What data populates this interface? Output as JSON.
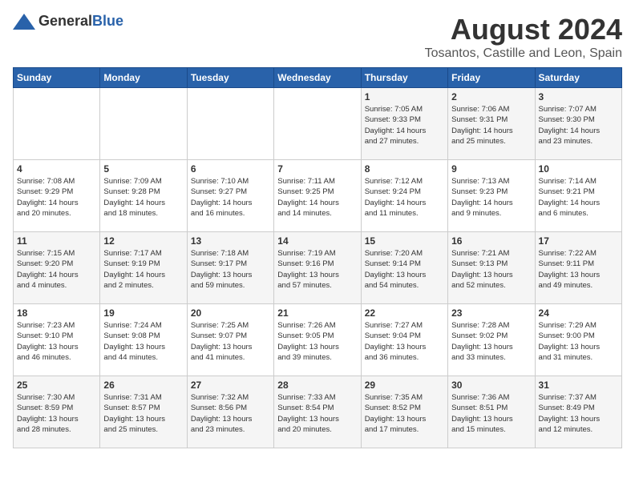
{
  "header": {
    "logo_general": "General",
    "logo_blue": "Blue",
    "month_year": "August 2024",
    "location": "Tosantos, Castille and Leon, Spain"
  },
  "days_of_week": [
    "Sunday",
    "Monday",
    "Tuesday",
    "Wednesday",
    "Thursday",
    "Friday",
    "Saturday"
  ],
  "weeks": [
    [
      {
        "day": "",
        "info": ""
      },
      {
        "day": "",
        "info": ""
      },
      {
        "day": "",
        "info": ""
      },
      {
        "day": "",
        "info": ""
      },
      {
        "day": "1",
        "info": "Sunrise: 7:05 AM\nSunset: 9:33 PM\nDaylight: 14 hours\nand 27 minutes."
      },
      {
        "day": "2",
        "info": "Sunrise: 7:06 AM\nSunset: 9:31 PM\nDaylight: 14 hours\nand 25 minutes."
      },
      {
        "day": "3",
        "info": "Sunrise: 7:07 AM\nSunset: 9:30 PM\nDaylight: 14 hours\nand 23 minutes."
      }
    ],
    [
      {
        "day": "4",
        "info": "Sunrise: 7:08 AM\nSunset: 9:29 PM\nDaylight: 14 hours\nand 20 minutes."
      },
      {
        "day": "5",
        "info": "Sunrise: 7:09 AM\nSunset: 9:28 PM\nDaylight: 14 hours\nand 18 minutes."
      },
      {
        "day": "6",
        "info": "Sunrise: 7:10 AM\nSunset: 9:27 PM\nDaylight: 14 hours\nand 16 minutes."
      },
      {
        "day": "7",
        "info": "Sunrise: 7:11 AM\nSunset: 9:25 PM\nDaylight: 14 hours\nand 14 minutes."
      },
      {
        "day": "8",
        "info": "Sunrise: 7:12 AM\nSunset: 9:24 PM\nDaylight: 14 hours\nand 11 minutes."
      },
      {
        "day": "9",
        "info": "Sunrise: 7:13 AM\nSunset: 9:23 PM\nDaylight: 14 hours\nand 9 minutes."
      },
      {
        "day": "10",
        "info": "Sunrise: 7:14 AM\nSunset: 9:21 PM\nDaylight: 14 hours\nand 6 minutes."
      }
    ],
    [
      {
        "day": "11",
        "info": "Sunrise: 7:15 AM\nSunset: 9:20 PM\nDaylight: 14 hours\nand 4 minutes."
      },
      {
        "day": "12",
        "info": "Sunrise: 7:17 AM\nSunset: 9:19 PM\nDaylight: 14 hours\nand 2 minutes."
      },
      {
        "day": "13",
        "info": "Sunrise: 7:18 AM\nSunset: 9:17 PM\nDaylight: 13 hours\nand 59 minutes."
      },
      {
        "day": "14",
        "info": "Sunrise: 7:19 AM\nSunset: 9:16 PM\nDaylight: 13 hours\nand 57 minutes."
      },
      {
        "day": "15",
        "info": "Sunrise: 7:20 AM\nSunset: 9:14 PM\nDaylight: 13 hours\nand 54 minutes."
      },
      {
        "day": "16",
        "info": "Sunrise: 7:21 AM\nSunset: 9:13 PM\nDaylight: 13 hours\nand 52 minutes."
      },
      {
        "day": "17",
        "info": "Sunrise: 7:22 AM\nSunset: 9:11 PM\nDaylight: 13 hours\nand 49 minutes."
      }
    ],
    [
      {
        "day": "18",
        "info": "Sunrise: 7:23 AM\nSunset: 9:10 PM\nDaylight: 13 hours\nand 46 minutes."
      },
      {
        "day": "19",
        "info": "Sunrise: 7:24 AM\nSunset: 9:08 PM\nDaylight: 13 hours\nand 44 minutes."
      },
      {
        "day": "20",
        "info": "Sunrise: 7:25 AM\nSunset: 9:07 PM\nDaylight: 13 hours\nand 41 minutes."
      },
      {
        "day": "21",
        "info": "Sunrise: 7:26 AM\nSunset: 9:05 PM\nDaylight: 13 hours\nand 39 minutes."
      },
      {
        "day": "22",
        "info": "Sunrise: 7:27 AM\nSunset: 9:04 PM\nDaylight: 13 hours\nand 36 minutes."
      },
      {
        "day": "23",
        "info": "Sunrise: 7:28 AM\nSunset: 9:02 PM\nDaylight: 13 hours\nand 33 minutes."
      },
      {
        "day": "24",
        "info": "Sunrise: 7:29 AM\nSunset: 9:00 PM\nDaylight: 13 hours\nand 31 minutes."
      }
    ],
    [
      {
        "day": "25",
        "info": "Sunrise: 7:30 AM\nSunset: 8:59 PM\nDaylight: 13 hours\nand 28 minutes."
      },
      {
        "day": "26",
        "info": "Sunrise: 7:31 AM\nSunset: 8:57 PM\nDaylight: 13 hours\nand 25 minutes."
      },
      {
        "day": "27",
        "info": "Sunrise: 7:32 AM\nSunset: 8:56 PM\nDaylight: 13 hours\nand 23 minutes."
      },
      {
        "day": "28",
        "info": "Sunrise: 7:33 AM\nSunset: 8:54 PM\nDaylight: 13 hours\nand 20 minutes."
      },
      {
        "day": "29",
        "info": "Sunrise: 7:35 AM\nSunset: 8:52 PM\nDaylight: 13 hours\nand 17 minutes."
      },
      {
        "day": "30",
        "info": "Sunrise: 7:36 AM\nSunset: 8:51 PM\nDaylight: 13 hours\nand 15 minutes."
      },
      {
        "day": "31",
        "info": "Sunrise: 7:37 AM\nSunset: 8:49 PM\nDaylight: 13 hours\nand 12 minutes."
      }
    ]
  ]
}
